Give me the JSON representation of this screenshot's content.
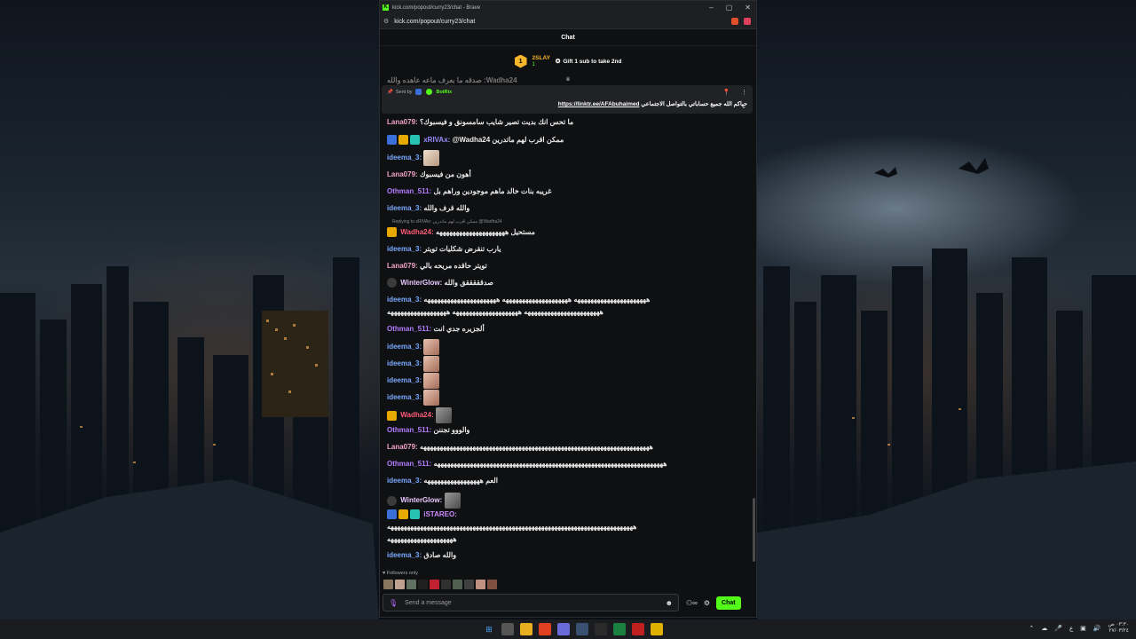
{
  "browser": {
    "tab_title": "kick.com/popout/curry23/chat - Brave",
    "url": "kick.com/popout/curry23/chat"
  },
  "chat": {
    "header": "Chat",
    "leaderboard": {
      "rank": "1",
      "user": "2SLAY",
      "count": "1",
      "gift_text": "Gift 1 sub to take 2nd"
    },
    "pinned": {
      "sent_by_label": "Sent by",
      "sender": "BotRix",
      "text": "حياكم الله جميع حساباتي بالتواصل الاجتماعي",
      "link": "https://linktr.ee/AFAbuhaimed"
    },
    "partial_top": "صدقه ما بعرف ماعه عاهده والله :Wadha24",
    "messages": [
      {
        "user": "Lana079",
        "text": "ما تحس انك بديت تصير شايب سامسونق و فيسبوك؟"
      },
      {
        "user": "xRIVAx",
        "text": "@Wadha24 ممكن اقرب لهم ماتدرين"
      },
      {
        "user": "ideema_3",
        "text": ""
      },
      {
        "user": "Lana079",
        "text": "أهون من فيسبوك"
      },
      {
        "user": "Othman_511",
        "text": "غريبه بنات خالد ماهم موجودين وراهم بل"
      },
      {
        "user": "ideema_3",
        "text": "والله قرف والله"
      },
      {
        "user": "Wadha24",
        "text": "مستحيل هههههههههههههههههههههه"
      },
      {
        "user": "ideema_3",
        "text": "يارب تنقرض شكليات تويتر"
      },
      {
        "user": "Lana079",
        "text": "تويتر حاقده مريحه بالي"
      },
      {
        "user": "WinterGlow",
        "text": "صدقققققق والله"
      },
      {
        "user": "ideema_3",
        "text": "ههههههههههههههههههههههه ههههههههههههههههههههه ههههههههههههههههههههههه"
      },
      {
        "user": "",
        "text": "هههههههههههههههههههههههه ههههههههههههههههههههه ههههههههههههههههههه"
      },
      {
        "user": "Othman_511",
        "text": "ألجزيره جدي انت"
      },
      {
        "user": "ideema_3",
        "text": ""
      },
      {
        "user": "ideema_3",
        "text": ""
      },
      {
        "user": "ideema_3",
        "text": ""
      },
      {
        "user": "ideema_3",
        "text": ""
      },
      {
        "user": "Wadha24",
        "text": ""
      },
      {
        "user": "Othman_511",
        "text": "والووو تجننن"
      },
      {
        "user": "Lana079",
        "text": "ههههههههههههههههههههههههههههههههههههههههههههههههههههههههههههههههههههههه"
      },
      {
        "user": "Othman_511",
        "text": "ههههههههههههههههههههههههههههههههههههههههههههههههههههههههههههههههههههههه"
      },
      {
        "user": "ideema_3",
        "text": "العم هههههههههههههههههه"
      },
      {
        "user": "WinterGlow",
        "text": ""
      },
      {
        "user": "iSTAREO",
        "text": "هههههههههههههههههههههههههههههههههههههههههههههههههههههههههههههههههههههههههههه"
      },
      {
        "user": "",
        "text": "ههههههههههههههههههههه"
      },
      {
        "user": "ideema_3",
        "text": "والله صادق"
      }
    ],
    "reply_note": "Replying to xRIVAx: ممكن اقرب لهم ماتدرين @Wadha24",
    "followers_only": "Followers only",
    "input_placeholder": "Send a message",
    "chat_button": "Chat"
  },
  "taskbar": {
    "time": "٠٣:٣٠ ص",
    "date": "٢٧/٠٣/٢٤",
    "lang": "ع"
  }
}
